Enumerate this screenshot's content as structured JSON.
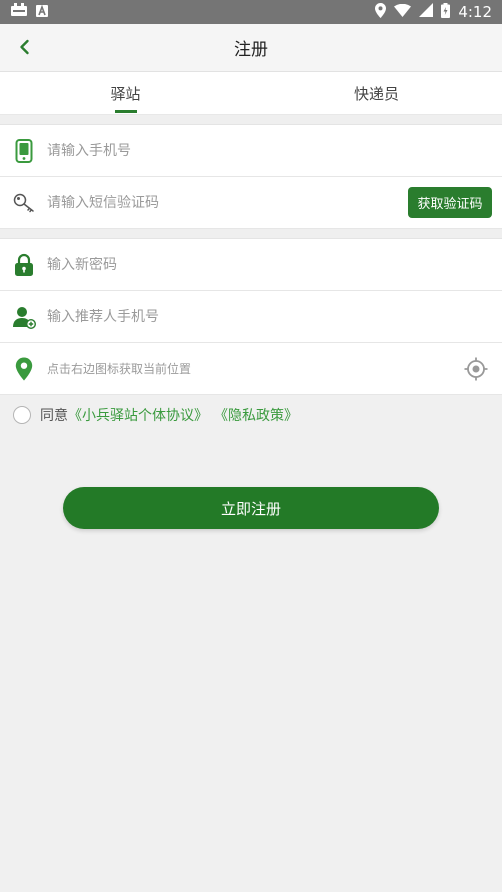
{
  "status_bar": {
    "time": "4:12"
  },
  "header": {
    "title": "注册"
  },
  "tabs": [
    {
      "label": "驿站",
      "active": true
    },
    {
      "label": "快递员",
      "active": false
    }
  ],
  "form": {
    "phone_placeholder": "请输入手机号",
    "sms_placeholder": "请输入短信验证码",
    "get_code_label": "获取验证码",
    "password_placeholder": "输入新密码",
    "referrer_placeholder": "输入推荐人手机号",
    "location_placeholder": "点击右边图标获取当前位置"
  },
  "agreement": {
    "prefix": "同意",
    "protocol_link": "《小兵驿站个体协议》",
    "privacy_link": "《隐私政策》"
  },
  "submit_label": "立即注册",
  "colors": {
    "primary": "#237a27",
    "link": "#3a9a3e",
    "background": "#f0f0f0",
    "status_bar": "#757575"
  },
  "icons": {
    "back": "chevron-left-icon",
    "phone": "phone-icon",
    "key": "key-icon",
    "lock": "lock-icon",
    "user": "user-add-icon",
    "location": "map-pin-icon",
    "locate": "crosshair-icon"
  }
}
